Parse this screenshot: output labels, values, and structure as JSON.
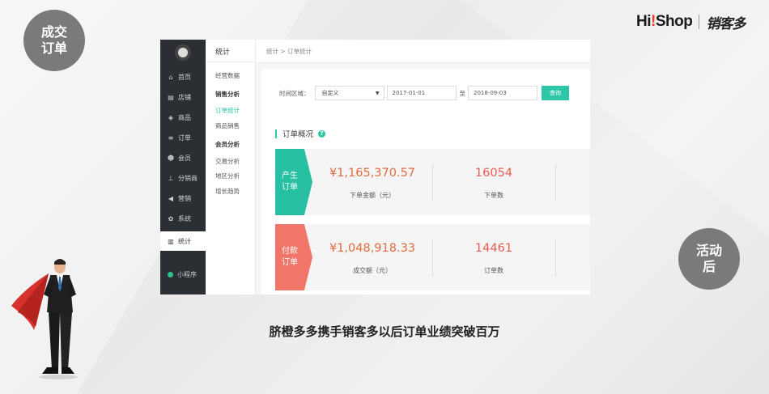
{
  "badges": {
    "before": "成交\n订单",
    "after": "活动\n后"
  },
  "logo": {
    "hishop_prefix": "Hi",
    "hishop_accent": "!",
    "hishop_suffix": "Shop",
    "xiaokeduo": "销客多"
  },
  "nav": {
    "items": [
      {
        "label": "首页",
        "icon": "home-icon"
      },
      {
        "label": "店铺",
        "icon": "store-icon"
      },
      {
        "label": "商品",
        "icon": "box-icon"
      },
      {
        "label": "订单",
        "icon": "list-icon"
      },
      {
        "label": "会员",
        "icon": "user-icon"
      },
      {
        "label": "分销商",
        "icon": "network-icon"
      },
      {
        "label": "营销",
        "icon": "megaphone-icon"
      },
      {
        "label": "系统",
        "icon": "gear-icon"
      },
      {
        "label": "统计",
        "icon": "chart-icon",
        "active": true
      },
      {
        "label": "小程序",
        "icon": "mini-program-icon"
      }
    ]
  },
  "subnav": {
    "title": "统计",
    "items": [
      {
        "label": "经营数据",
        "kind": "link"
      },
      {
        "label": "销售分析",
        "kind": "group"
      },
      {
        "label": "订单统计",
        "kind": "active"
      },
      {
        "label": "商品销售",
        "kind": "link"
      },
      {
        "label": "会员分析",
        "kind": "group"
      },
      {
        "label": "交易分析",
        "kind": "link"
      },
      {
        "label": "地区分析",
        "kind": "link"
      },
      {
        "label": "增长趋势",
        "kind": "link"
      }
    ]
  },
  "breadcrumb": "统计 > 订单统计",
  "filter": {
    "label": "时间区域：",
    "range_value": "自定义",
    "start_date": "2017-01-01",
    "to_label": "至",
    "end_date": "2018-09-03",
    "query_button": "查询"
  },
  "overview": {
    "title": "订单概况",
    "cards": [
      {
        "tag": "产生\n订单",
        "amount": "¥1,165,370.57",
        "amount_label": "下单金额（元）",
        "count": "16054",
        "count_label": "下单数"
      },
      {
        "tag": "付款\n订单",
        "amount": "¥1,048,918.33",
        "amount_label": "成交额（元）",
        "count": "14461",
        "count_label": "订单数"
      }
    ]
  },
  "caption": "脐橙多多携手销客多以后订单业绩突破百万",
  "colors": {
    "accent": "#2ec6a9",
    "card_green": "#27c0a3",
    "card_red": "#f2756a",
    "value_orange": "#e36a3d",
    "nav_bg": "#2b2e33"
  }
}
